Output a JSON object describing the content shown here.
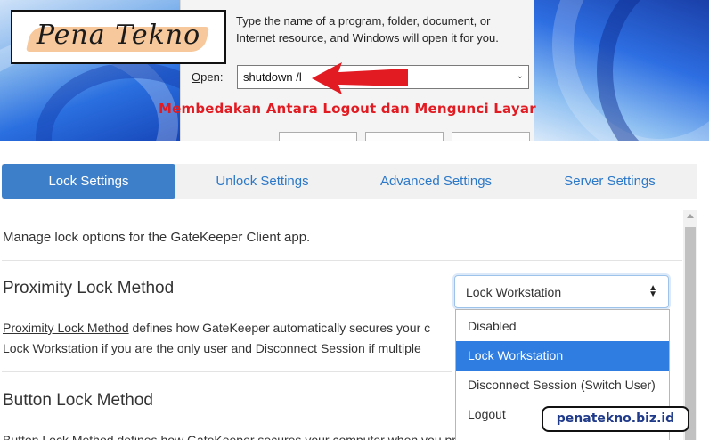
{
  "brand": {
    "logo_text": "Pena Tekno",
    "site": "penatekno.biz.id",
    "headline": "Membedakan Antara Logout dan Mengunci Layar",
    "accent_red": "#e21b22"
  },
  "run_dialog": {
    "description": "Type the name of a program, folder, document, or Internet resource, and Windows will open it for you.",
    "open_label_hotkey": "O",
    "open_label_rest": "pen:",
    "open_value": "shutdown /l"
  },
  "tabs": [
    {
      "label": "Lock Settings",
      "active": true
    },
    {
      "label": "Unlock Settings",
      "active": false
    },
    {
      "label": "Advanced Settings",
      "active": false
    },
    {
      "label": "Server Settings",
      "active": false
    }
  ],
  "settings": {
    "intro": "Manage lock options for the GateKeeper Client app.",
    "proximity": {
      "heading": "Proximity Lock Method",
      "line1_link": "Proximity Lock Method",
      "line1_rest": " defines how GateKeeper automatically secures your c",
      "line2_link1": "Lock Workstation",
      "line2_mid": " if you are the only user and ",
      "line2_link2": "Disconnect Session",
      "line2_rest": " if multiple"
    },
    "button": {
      "heading": "Button Lock Method",
      "line1": "Button Lock Method defines how GateKeeper secures your computer when you press the button on your token"
    },
    "select": {
      "value": "Lock Workstation",
      "options": [
        "Disabled",
        "Lock Workstation",
        "Disconnect Session (Switch User)",
        "Logout"
      ],
      "selected_index": 1
    }
  },
  "colors": {
    "tab_active": "#3e7fc9",
    "tab_link": "#2c78c8",
    "option_selected": "#2f7de1"
  }
}
